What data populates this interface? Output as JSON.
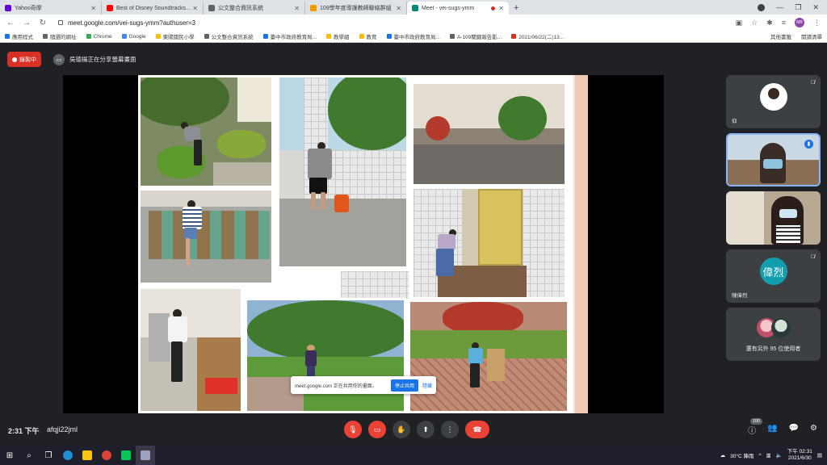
{
  "browser": {
    "tabs": [
      {
        "title": "Yahoo奇摩",
        "color": "#6001d2",
        "active": false
      },
      {
        "title": "Best of Disney Soundtracks Pla",
        "color": "#ff0000",
        "active": false
      },
      {
        "title": "公文整合資訊系統",
        "color": "#5f6368",
        "active": false
      },
      {
        "title": "109學年度導護教師聯絡群組",
        "color": "#f29900",
        "active": false
      },
      {
        "title": "Meet - vei-sugs-ymm",
        "color": "#00897b",
        "active": true
      }
    ],
    "url": "meet.google.com/vei-sugs-ymm?authuser=3",
    "profile": "MB",
    "bookmarks": [
      {
        "label": "應用程式",
        "color": "#1a73e8"
      },
      {
        "label": "隨選的網址",
        "color": "#5f6368"
      },
      {
        "label": "Chrome",
        "color": "#34a853"
      },
      {
        "label": "Google",
        "color": "#4285f4"
      },
      {
        "label": "東陽國民小學",
        "color": "#fbbc04"
      },
      {
        "label": "公文整合資訊系統",
        "color": "#5f6368"
      },
      {
        "label": "臺中市政府教育局...",
        "color": "#1a73e8"
      },
      {
        "label": "教學組",
        "color": "#fbbc04"
      },
      {
        "label": "教育",
        "color": "#fbbc04"
      },
      {
        "label": "臺中市政府教育局...",
        "color": "#1a73e8"
      },
      {
        "label": "A-109關鍵報告影...",
        "color": "#5f6368"
      },
      {
        "label": "2021/06/22(二)13...",
        "color": "#d93025"
      }
    ],
    "bookmarks_right": [
      "其他書籤",
      "閱讀清單"
    ]
  },
  "meet": {
    "recording_label": "錄製中",
    "presenter_text": "吳德揚正在分享螢幕畫面",
    "share_popup": {
      "text": "meet.google.com 正在共用你的畫面。",
      "stop_label": "停止共用",
      "hide_label": "隱藏"
    },
    "participants": [
      {
        "name": "仰",
        "type": "avatar",
        "initial": "",
        "color": "#ffffff"
      },
      {
        "name": "",
        "type": "video",
        "initial": "",
        "color": "#b7c9d6"
      },
      {
        "name": "",
        "type": "video",
        "initial": "",
        "color": "#d8cfc3"
      },
      {
        "name": "陳偉烈",
        "type": "initial",
        "initial": "偉烈",
        "color": "#129eaf"
      }
    ],
    "others_text": "還有另外 95 位使用者",
    "time": "2:31 下午",
    "meeting_code": "afqji22jml",
    "participant_count": "100"
  },
  "taskbar": {
    "weather": "30°C 陣雨",
    "time": "下午 02:31",
    "date": "2021/6/30",
    "apps": [
      {
        "name": "file-explorer",
        "color": "#f9c513"
      },
      {
        "name": "chrome",
        "color": "#db4437"
      },
      {
        "name": "line",
        "color": "#06c755"
      },
      {
        "name": "meet-window",
        "color": "#a0a0c0"
      }
    ]
  }
}
